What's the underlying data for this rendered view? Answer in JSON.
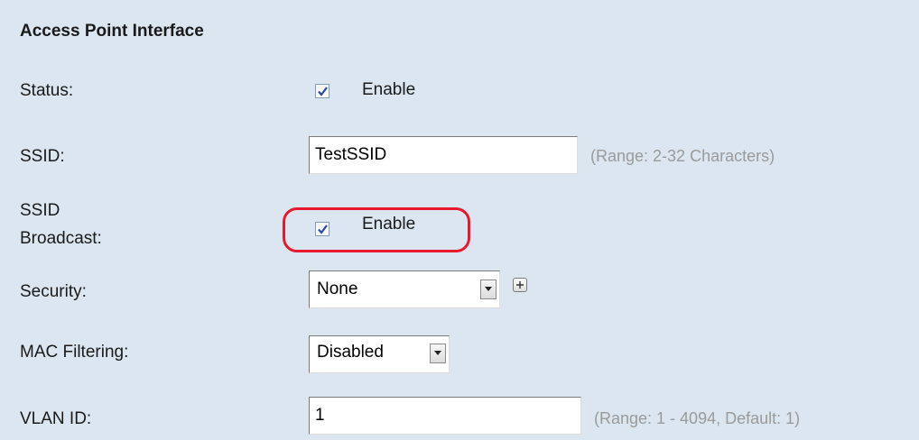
{
  "section": {
    "title": "Access Point Interface"
  },
  "status": {
    "label": "Status:",
    "checked": true,
    "checkbox_label": "Enable"
  },
  "ssid": {
    "label": "SSID:",
    "value": "TestSSID",
    "hint": "(Range: 2-32 Characters)"
  },
  "ssid_broadcast": {
    "label_line1": "SSID",
    "label_line2": "Broadcast:",
    "checked": true,
    "checkbox_label": "Enable"
  },
  "security": {
    "label": "Security:",
    "selected": "None",
    "expand_icon": "plus-icon"
  },
  "mac_filtering": {
    "label": "MAC Filtering:",
    "selected": "Disabled"
  },
  "vlan_id": {
    "label": "VLAN ID:",
    "value": "1",
    "hint": "(Range: 1 - 4094, Default: 1)"
  },
  "colors": {
    "panel_background": "#dce6f1",
    "highlight": "#e8192c",
    "hint_text": "#9a9a9a",
    "checkmark": "#2a4aa8"
  }
}
